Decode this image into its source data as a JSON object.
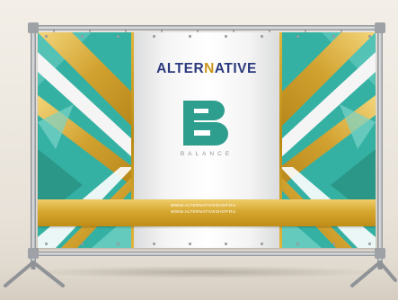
{
  "scene": {
    "description_colors": {
      "teal": "#2fa79a",
      "gold": "#d6a72f",
      "navy": "#2b3a7d",
      "frame_steel": "#a9adb1"
    }
  },
  "banner": {
    "brand_part1": "ALTER",
    "brand_part2": "N",
    "brand_part3": "ATIVE",
    "sub_brand": "BALANCE",
    "website_line1": "WWW.ALTERNATIVESHOP.RU",
    "website_line2": "WWW.ALTERNATIVESHOP.RU"
  }
}
